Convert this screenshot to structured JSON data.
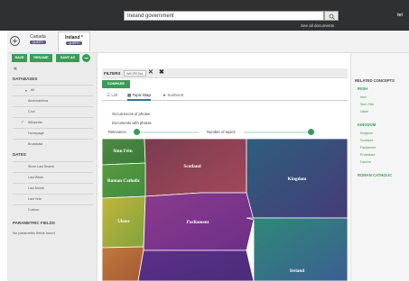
{
  "search": {
    "query": "Ireland government",
    "see_all": "See all documents",
    "user": "tel"
  },
  "query_tabs": [
    {
      "name": "Canada",
      "badge": "QUERY"
    },
    {
      "name": "Ireland *",
      "badge": "QUERY"
    }
  ],
  "sidebar": {
    "buttons": {
      "save": "SAVE",
      "rename": "RENAME",
      "save_as": "SAVE AS"
    },
    "collapse_glyph": "«",
    "databases": {
      "title": "DATABASES",
      "items": [
        "All",
        "Americanflora",
        "Cool",
        "Wikipedia",
        "Homepage",
        "Broadcast"
      ]
    },
    "dates": {
      "title": "DATES",
      "items": [
        "Since Last Search",
        "Last Week",
        "Last Month",
        "Last Year",
        "Custom"
      ]
    },
    "parametric": {
      "title": "PARAMETRIC FIELDS",
      "empty": "No parametric fields found"
    }
  },
  "filters": {
    "label": "FILTERS",
    "chip": "WIKIPEDIA"
  },
  "compare_label": "COMPARE",
  "views": {
    "list": "List",
    "topic_map": "Topic Map",
    "sunburst": "Sunburst"
  },
  "options": {
    "occurrences": "Occurrences of phrase",
    "documents": "Documents with phrase",
    "relevance": "Relevance",
    "topics": "Number of topics"
  },
  "treemap_labels": {
    "sinn_fein": "Sinn Féin",
    "scotland": "Scotland",
    "kingdom": "Kingdom",
    "roman_catholic": "Roman Catholic",
    "ulster": "Ulster",
    "parliament": "Parliament",
    "ireland": "Ireland"
  },
  "related": {
    "title": "RELATED CONCEPTS",
    "groups": [
      {
        "head": "IRISH",
        "items": [
          "Irish",
          "Sinn Féin",
          "Ulster"
        ]
      },
      {
        "head": "KINGDOM",
        "items": [
          "Kingdom",
          "Scotland",
          "Parliament",
          "Protestant",
          "Famine"
        ]
      },
      {
        "head": "ROMAN CATHOLIC",
        "items": []
      }
    ]
  },
  "colors": {
    "accent": "#3a9b58",
    "topbar": "#2f3032",
    "badge": "#5e5480"
  }
}
